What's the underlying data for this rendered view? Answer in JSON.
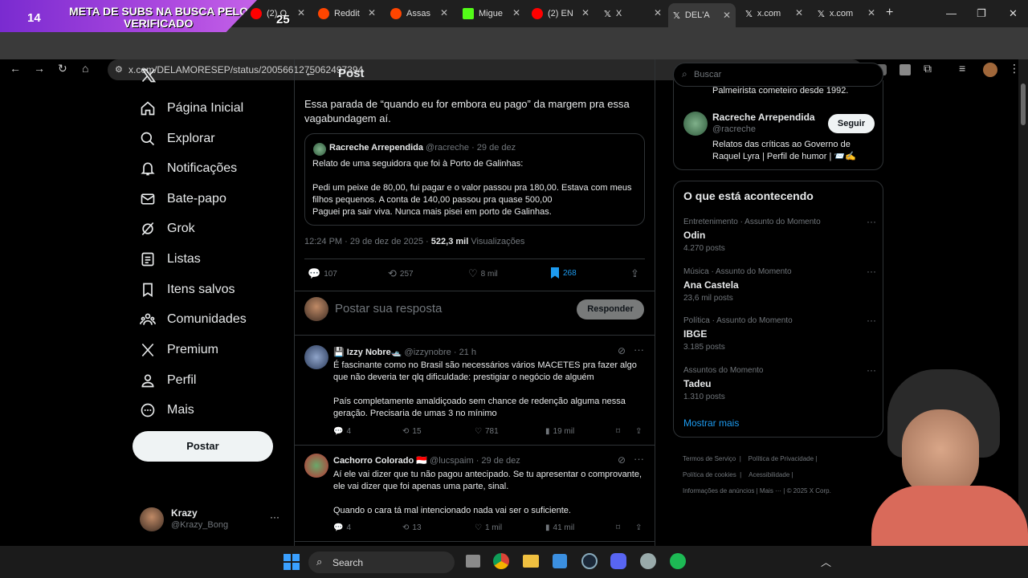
{
  "overlay": {
    "count": "14",
    "text_line1": "META DE SUBS NA BUSCA PELO",
    "text_line2": "VERIFICADO",
    "count2": "25"
  },
  "browser": {
    "tabs": [
      {
        "label": "(2) O",
        "color": "#ff0000"
      },
      {
        "label": "Reddit",
        "color": "#ff4500"
      },
      {
        "label": "Assas",
        "color": "#ff4500"
      },
      {
        "label": "Migue",
        "color": "#53fc18"
      },
      {
        "label": "(2) EN",
        "color": "#ff0000"
      },
      {
        "label": "X",
        "color": "#ffffff"
      },
      {
        "label": "DEL'A",
        "color": "#ffffff"
      },
      {
        "label": "x.com",
        "color": "#ffffff"
      },
      {
        "label": "x.com",
        "color": "#ffffff"
      }
    ],
    "url": "x.com/DELAMORESEP/status/2005661275062497394"
  },
  "sidebar": {
    "items": [
      {
        "label": "Página Inicial",
        "icon": "home-icon"
      },
      {
        "label": "Explorar",
        "icon": "search-icon"
      },
      {
        "label": "Notificações",
        "icon": "bell-icon"
      },
      {
        "label": "Bate-papo",
        "icon": "mail-icon"
      },
      {
        "label": "Grok",
        "icon": "grok-icon"
      },
      {
        "label": "Listas",
        "icon": "list-icon"
      },
      {
        "label": "Itens salvos",
        "icon": "bookmark-icon"
      },
      {
        "label": "Comunidades",
        "icon": "communities-icon"
      },
      {
        "label": "Premium",
        "icon": "x-icon"
      },
      {
        "label": "Perfil",
        "icon": "profile-icon"
      },
      {
        "label": "Mais",
        "icon": "more-icon"
      }
    ],
    "post_label": "Postar",
    "account": {
      "name": "Krazy",
      "handle": "@Krazy_Bong"
    }
  },
  "main": {
    "header": "Post",
    "tweet_text": "Essa parada de “quando eu for embora eu pago” da margem pra essa vagabundagem aí.",
    "quote": {
      "name": "Racreche Arrependida",
      "handle": "@racreche",
      "date": "· 29 de dez",
      "line1": "Relato de uma seguidora que foi à Porto de Galinhas:",
      "line2": "Pedi um peixe de 80,00, fui pagar e o valor passou pra 180,00. Estava com meus filhos pequenos. A conta de 140,00 passou pra quase 500,00",
      "line3": "Paguei pra sair viva. Nunca mais pisei em porto de Galinhas."
    },
    "meta": {
      "time": "12:24 PM · 29 de dez de 2025 · ",
      "views": "522,3 mil",
      "views_label": " Visualizações"
    },
    "actions": {
      "replies": "107",
      "reposts": "257",
      "likes": "8 mil",
      "bookmarks": "268"
    },
    "reply_placeholder": "Postar sua resposta",
    "reply_button": "Responder",
    "replies": [
      {
        "name": "💾 Izzy Nobre🛥️",
        "handle": "@izzynobre",
        "time": "· 21 h",
        "p1": "É fascinante como no Brasil são necessários vários MACETES pra fazer algo que não deveria ter qlq dificuldade: prestigiar o negócio de alguém",
        "p2": "País completamente amaldiçoado sem chance de redenção alguma nessa geração. Precisaria de umas 3 no mínimo",
        "replies": "4",
        "reposts": "15",
        "likes": "781",
        "views": "19 mil"
      },
      {
        "name": "Cachorro Colorado 🇮🇩",
        "handle": "@lucspaim",
        "time": "· 29 de dez",
        "p1": "Aí ele vai dizer que tu não pagou antecipado. Se tu apresentar o comprovante, ele vai dizer que foi apenas uma parte, sinal.",
        "p2": "Quando o cara tá mal intencionado nada vai ser o suficiente.",
        "replies": "4",
        "reposts": "13",
        "likes": "1 mil",
        "views": "41 mil"
      }
    ]
  },
  "right": {
    "search_placeholder": "Buscar",
    "cutoff_text": "Palmeirista cometeiro desde 1992.",
    "follow": {
      "name": "Racreche Arrependida",
      "handle": "@racreche",
      "button": "Seguir",
      "bio": "Relatos das críticas ao Governo de Raquel Lyra | Perfil de humor | 📨✍️"
    },
    "trends_title": "O que está acontecendo",
    "trends": [
      {
        "category": "Entretenimento · Assunto do Momento",
        "name": "Odin",
        "count": "4.270 posts"
      },
      {
        "category": "Música · Assunto do Momento",
        "name": "Ana Castela",
        "count": "23,6 mil posts"
      },
      {
        "category": "Política · Assunto do Momento",
        "name": "IBGE",
        "count": "3.185 posts"
      },
      {
        "category": "Assuntos do Momento",
        "name": "Tadeu",
        "count": "1.310 posts"
      }
    ],
    "show_more": "Mostrar mais",
    "footer": [
      "Termos de Serviço",
      "Política de Privacidade",
      "Política de cookies",
      "Acessibilidade",
      "Informações de anúncios",
      "Mais ···",
      "© 2025 X Corp."
    ]
  },
  "taskbar": {
    "search": "Search"
  }
}
